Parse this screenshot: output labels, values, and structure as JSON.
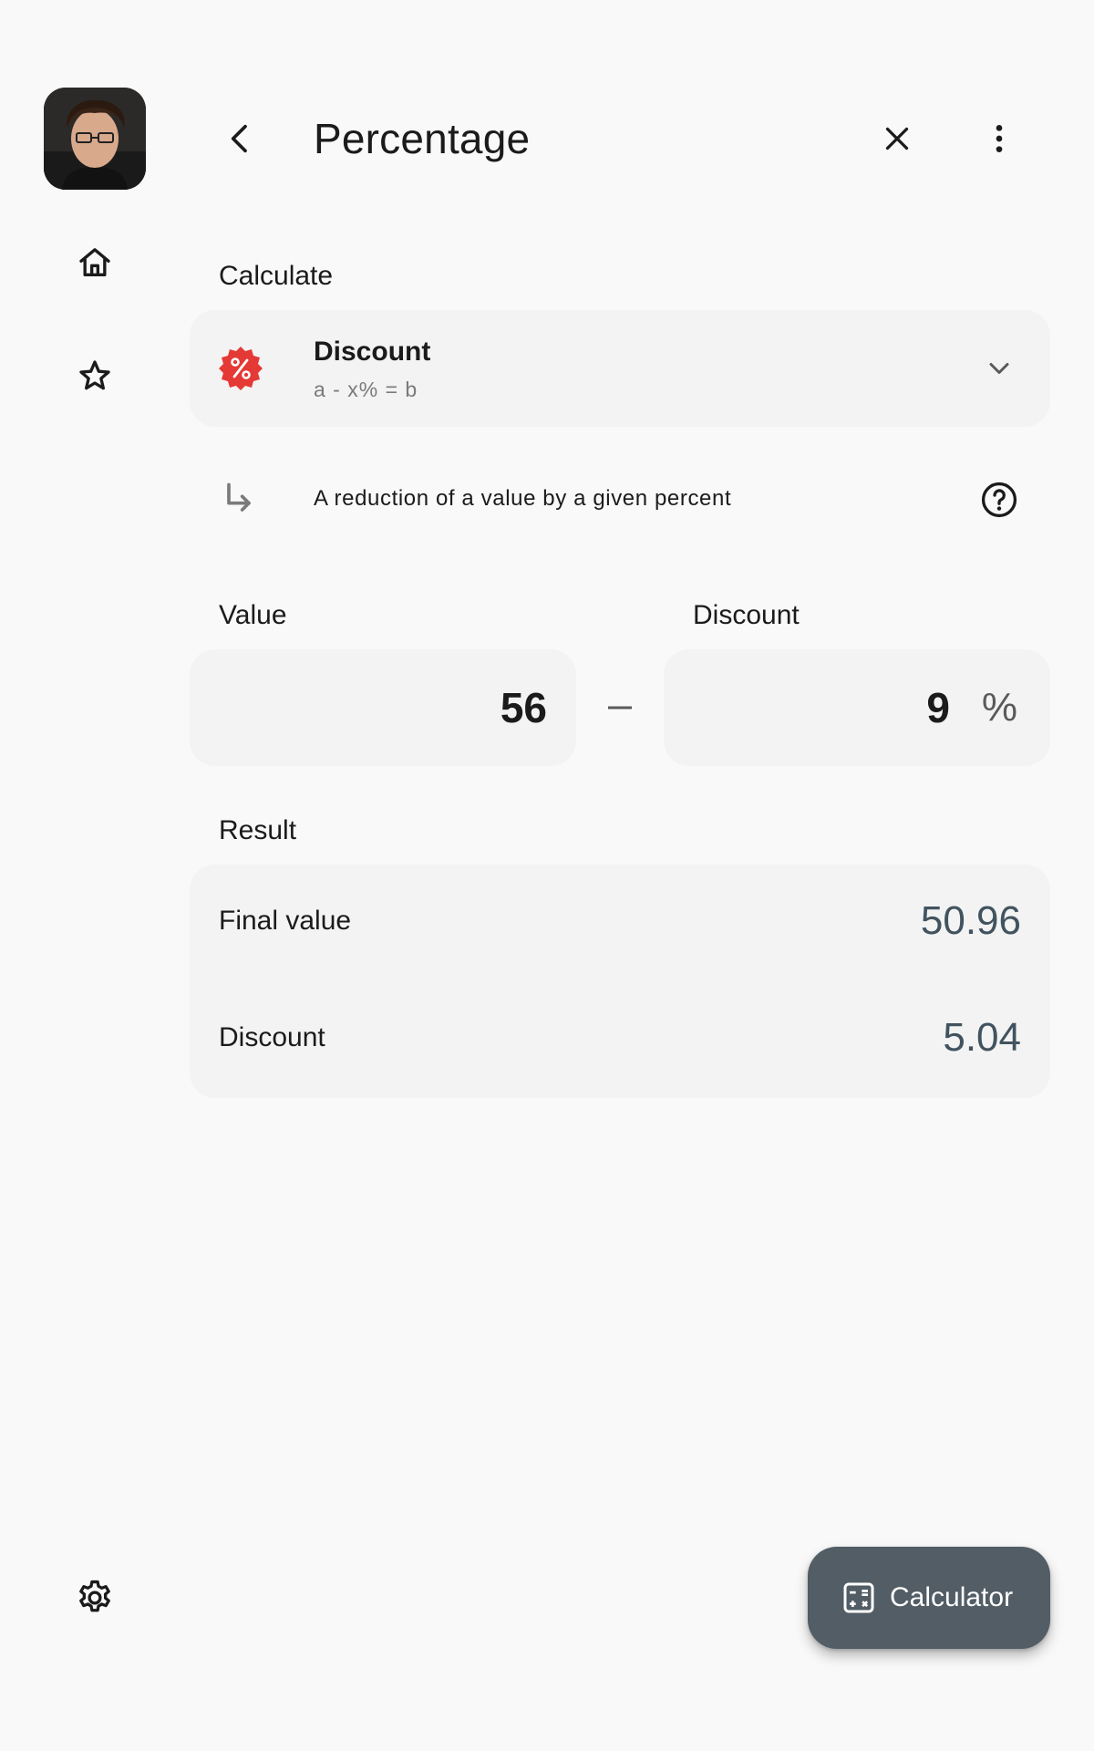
{
  "header": {
    "title": "Percentage"
  },
  "calculate": {
    "label": "Calculate",
    "mode": {
      "name": "Discount",
      "formula": "a - x% = b",
      "description": "A reduction of a value by a given percent"
    }
  },
  "inputs": {
    "value_label": "Value",
    "value": "56",
    "discount_label": "Discount",
    "discount": "9",
    "discount_unit": "%"
  },
  "result": {
    "label": "Result",
    "rows": [
      {
        "label": "Final value",
        "value": "50.96"
      },
      {
        "label": "Discount",
        "value": "5.04"
      }
    ]
  },
  "fab": {
    "label": "Calculator"
  },
  "icons": {
    "avatar": "avatar",
    "home": "home-icon",
    "star": "star-icon",
    "settings": "gear-icon",
    "back": "arrow-back-icon",
    "close": "close-icon",
    "more": "more-vert-icon",
    "mode": "percent-badge-icon",
    "dropdown": "chevron-down-icon",
    "subdirectory": "subdirectory-arrow-icon",
    "help": "help-circle-icon",
    "minus": "minus-icon",
    "calculator": "calculator-icon"
  },
  "colors": {
    "background": "#f9f9f9",
    "surface": "#f3f3f3",
    "accent_red": "#e53935",
    "result_value": "#41535f",
    "fab": "#525d65"
  }
}
